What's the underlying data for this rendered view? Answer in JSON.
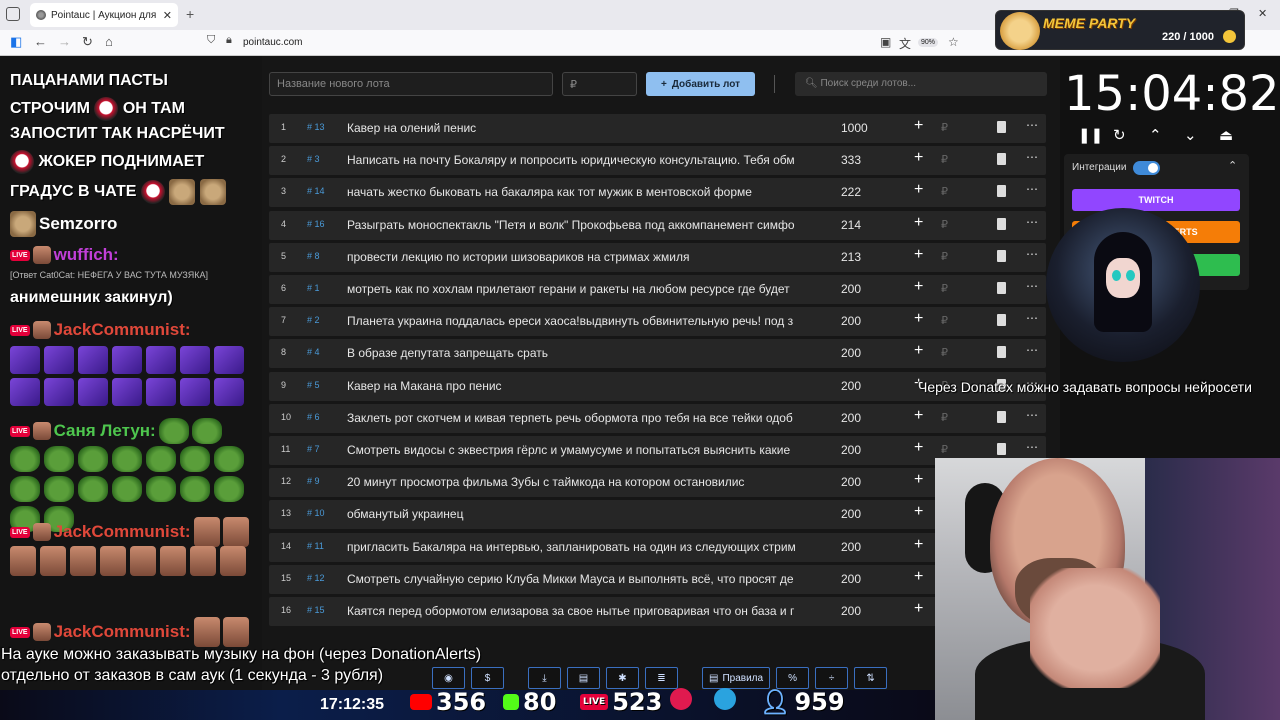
{
  "browser": {
    "tab_title": "Pointauc | Аукцион для стримера",
    "url": "pointauc.com",
    "zoom": "90%"
  },
  "meme": {
    "title": "MEME PARTY",
    "count": "220 / 1000"
  },
  "chat": {
    "lines": [
      "ПАЦАНАМИ ПАСТЫ",
      "СТРОЧИМ",
      "ОН ТАМ",
      "ЗАПОСТИТ ТАК НАСРЁЧИТ",
      "ЖОКЕР ПОДНИМАЕТ",
      "ГРАДУС В ЧАТЕ"
    ],
    "users": [
      "Semzorro",
      "wuffich:",
      "JackCommunist:",
      "Саня Летун:",
      "JackCommunist:",
      "JackCommunist:"
    ],
    "reply": "[Ответ Cat0Cat: НЕФЕГА У ВАС ТУТА МУЗЯКА]",
    "message": "анимешник закинул)",
    "live": "LIVE"
  },
  "form": {
    "lot_placeholder": "Название нового лота",
    "amount_placeholder": "₽",
    "add_button": "Добавить лот",
    "search_placeholder": "Поиск среди лотов..."
  },
  "lots": [
    {
      "n": "1",
      "id": "# 13",
      "name": "Кавер на олений пенис",
      "amount": "1000"
    },
    {
      "n": "2",
      "id": "# 3",
      "name": "Написать на почту Бокаляру и попросить юридическую консультацию. Тебя обм",
      "amount": "333"
    },
    {
      "n": "3",
      "id": "# 14",
      "name": "начать жестко быковать на бакаляра как тот мужик в ментовской форме",
      "amount": "222"
    },
    {
      "n": "4",
      "id": "# 16",
      "name": "Разыграть моноспектакль \"Петя и волк\" Прокофьева под аккомпанемент симфо",
      "amount": "214"
    },
    {
      "n": "5",
      "id": "# 8",
      "name": "провести лекцию по истории шизовариков на стримах жмиля",
      "amount": "213"
    },
    {
      "n": "6",
      "id": "# 1",
      "name": "мотреть как по хохлам прилетают герани и ракеты на любом ресурсе где будет",
      "amount": "200"
    },
    {
      "n": "7",
      "id": "# 2",
      "name": "Планета украина поддалась ереси хаоса!выдвинуть обвинительную речь! под з",
      "amount": "200"
    },
    {
      "n": "8",
      "id": "# 4",
      "name": "В образе депутата запрещать срать",
      "amount": "200"
    },
    {
      "n": "9",
      "id": "# 5",
      "name": "Кавер на Макана про пенис",
      "amount": "200"
    },
    {
      "n": "10",
      "id": "# 6",
      "name": "Заклеть рот скотчем и кивая терпеть речь обормота про тебя на все тейки одоб",
      "amount": "200"
    },
    {
      "n": "11",
      "id": "# 7",
      "name": "Смотреть видосы с эквестрия гёрлс и умамусуме и попытаться выяснить какие",
      "amount": "200"
    },
    {
      "n": "12",
      "id": "# 9",
      "name": "20 минут просмотра фильма Зубы с таймкода на котором остановилис",
      "amount": "200"
    },
    {
      "n": "13",
      "id": "# 10",
      "name": "обманутый украинец",
      "amount": "200"
    },
    {
      "n": "14",
      "id": "# 11",
      "name": "пригласить Бакаляра на интервью, запланировать на один из следующих стрим",
      "amount": "200"
    },
    {
      "n": "15",
      "id": "# 12",
      "name": "Смотреть случайную серию Клуба Микки Мауса и выполнять всё, что просят де",
      "amount": "200"
    },
    {
      "n": "16",
      "id": "# 15",
      "name": "Каятся перед обормотом елизарова за свое нытье приговаривая что он база и г",
      "amount": "200"
    }
  ],
  "timer": {
    "value": "15:04:82"
  },
  "integrations": {
    "label": "Интеграции",
    "twitch": "TWITCH",
    "da": "DONATIONALERTS",
    "third": "",
    "colors": {
      "twitch": "#9146ff",
      "da": "#f57d07",
      "third": "#2ebd4f"
    }
  },
  "overlay": {
    "donatex": "Через Donatex можно задавать вопросы нейросети",
    "music1": "На ауке можно заказывать музыку на фон (через DonationAlerts)",
    "music2": "отдельно от заказов в сам аук (1 секунда - 3 рубля)",
    "rules": "Правила",
    "clock": "17:12:35",
    "stats": {
      "youtube": "356",
      "kick": "80",
      "vk": "523",
      "telegram": "",
      "viewers": "959"
    }
  }
}
